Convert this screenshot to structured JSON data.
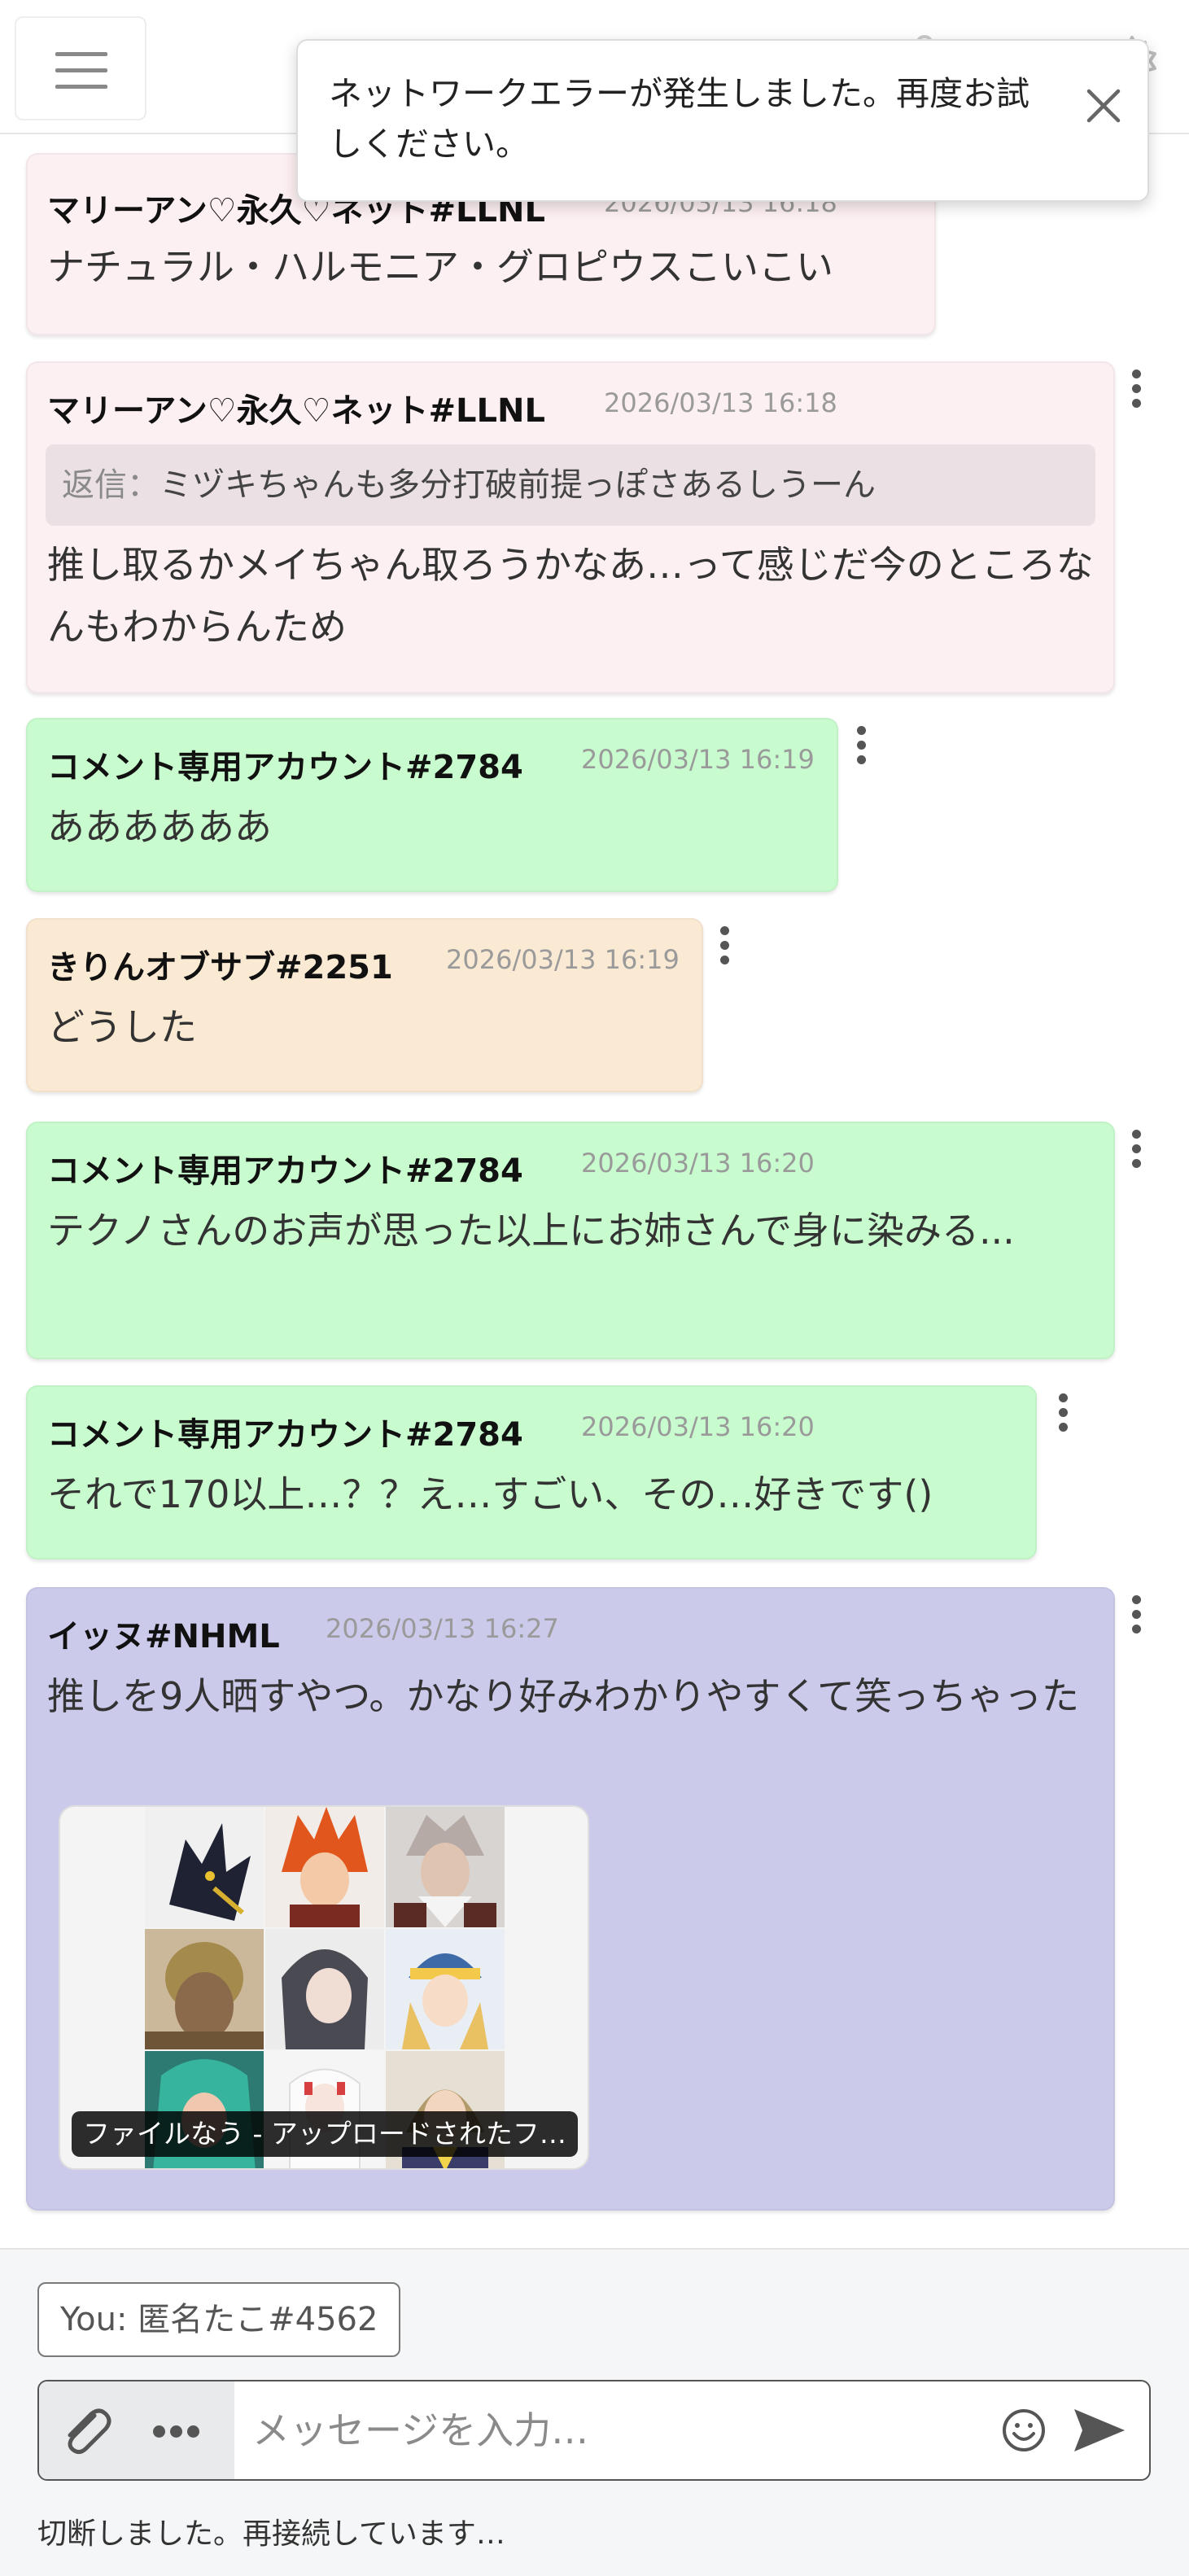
{
  "toast": {
    "message": "ネットワークエラーが発生しました。再度お試しください。"
  },
  "messages": [
    {
      "author": "マリーアン♡永久♡ネット#LLNL",
      "time": "2026/03/13 16:18",
      "text": "ナチュラル・ハルモニア・グロピウスこいこい",
      "color": "#fdf0f2"
    },
    {
      "author": "マリーアン♡永久♡ネット#LLNL",
      "time": "2026/03/13 16:18",
      "reply_label": "返信：",
      "reply_text": "ミヅキちゃんも多分打破前提っぽさあるしうーん",
      "text": "推し取るかメイちゃん取ろうかなあ…って感じだ今のところなんもわからんため",
      "color": "#fdf0f2"
    },
    {
      "author": "コメント専用アカウント#2784",
      "time": "2026/03/13 16:19",
      "text": "ああああああ",
      "color": "#c8fccf"
    },
    {
      "author": "きりんオブサブ#2251",
      "time": "2026/03/13 16:19",
      "text": "どうした",
      "color": "#fbead3"
    },
    {
      "author": "コメント専用アカウント#2784",
      "time": "2026/03/13 16:20",
      "text": "テクノさんのお声が思った以上にお姉さんで身に染みる...",
      "color": "#c8fccf"
    },
    {
      "author": "コメント専用アカウント#2784",
      "time": "2026/03/13 16:20",
      "text": "それで170以上…？？え…すごい、その…好きです()",
      "color": "#c8fccf"
    },
    {
      "author": "イッヌ#NHML",
      "time": "2026/03/13 16:27",
      "text": "推しを9人晒すやつ。かなり好みわかりやすくて笑っちゃった",
      "attachment_caption": "ファイルなう - アップロードされたフ…",
      "color": "#cbcaeb"
    }
  ],
  "footer": {
    "user_badge": "You: 匿名たこ#4562",
    "input_placeholder": "メッセージを入力…",
    "status": "切断しました。再接続しています…"
  }
}
